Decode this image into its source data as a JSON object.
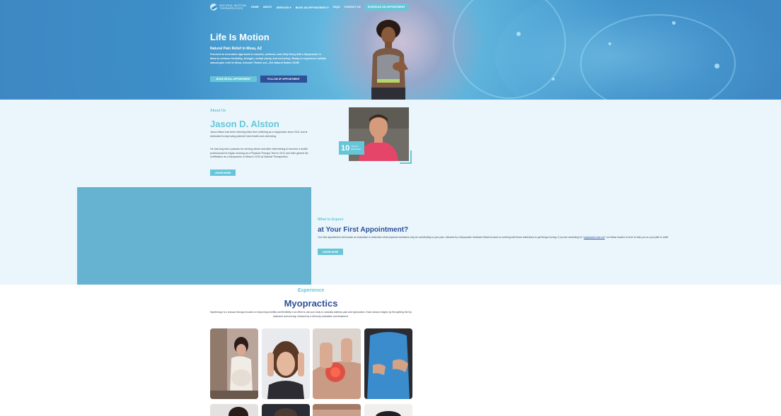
{
  "nav": {
    "logo_line1": "NATURAL MOTION",
    "logo_line2": "THERAPEUTICS",
    "items": [
      {
        "label": "HOME"
      },
      {
        "label": "ABOUT"
      },
      {
        "label": "SERVICES",
        "has_dropdown": true
      },
      {
        "label": "BOOK AN APPOINTMENT",
        "has_dropdown": true
      },
      {
        "label": "FAQS"
      },
      {
        "label": "CONTACT US"
      }
    ],
    "cta_label": "SCHEDULE AN APPOINTMENT"
  },
  "hero": {
    "title": "Life Is Motion",
    "subtitle": "Natural Pain Relief in Mesa, AZ",
    "description": "Focused on innovative approach to muscles, wellness, and daily living with a Myopractor in Mesa to enhance flexibility, strength, mental clarity, and well-being. Ready to experience holistic natural pain relief in Mesa, Arizona? Reach out—Get Natural Motion NOW!",
    "btn_initial": "BOOK INITIAL APPOINTMENT",
    "btn_follow": "FOLLOW UP APPOINTMENT"
  },
  "about": {
    "eyebrow": "About Us",
    "name": "Jason D. Alston",
    "p1": "Jason Alston has been relieving folks from suffering as a myopractor since 2011 and is dedicated to improving patients' best health and well-being.",
    "p2": "He has long had a passion for serving others and after determining to become a health professional he began working as a Physical Therapy Tech in 2011 and later gained his certification as a Myopractor in Mesa in 2013 at Natural Therapeutics.",
    "btn": "LEARN MORE",
    "badge_number": "10",
    "badge_label": "Years of Experience"
  },
  "appointment": {
    "eyebrow": "What to Expect",
    "title": "at Your First Appointment?",
    "desc_before": "Your first appointment will include an evaluation to determine what physical restrictions may be contributing to your pain, followed by a Myopractic treatment Mesa focused on working with those restrictions to get things moving. If you are searching for \"",
    "desc_link": "myopractic near me",
    "desc_after": "\" our Mesa location is here to help you on your path to relief.",
    "btn": "LEARN MORE"
  },
  "experience": {
    "eyebrow": "Experience",
    "title": "Myopractics",
    "desc": "Myotherapy is a manual therapy focused on improving mobility and flexibility in an effort to aid your body to naturally address pain and dysfunction. Each session begins by first getting the hip balanced and moving, followed by a full body evaluation and treatment."
  },
  "colors": {
    "accent": "#66c6d9",
    "navy": "#2f4f98",
    "light_bg": "#eaf6fb"
  }
}
